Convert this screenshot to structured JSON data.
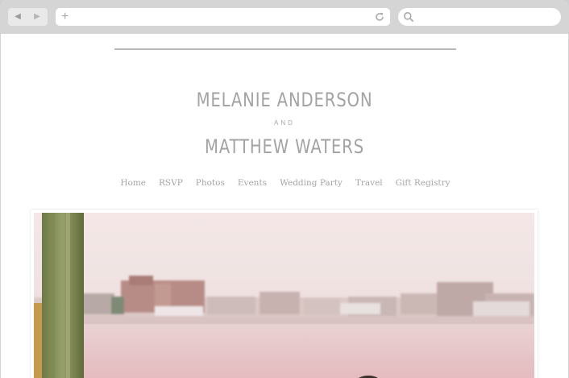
{
  "browser": {
    "back_icon": "back-arrow-icon",
    "forward_icon": "forward-arrow-icon",
    "new_tab_icon": "plus-icon",
    "reload_icon": "reload-icon",
    "search_icon": "search-icon",
    "address_value": "",
    "search_value": ""
  },
  "site": {
    "name_1": "MELANIE ANDERSON",
    "and": "AND",
    "name_2": "MATTHEW WATERS",
    "nav": [
      "Home",
      "RSVP",
      "Photos",
      "Events",
      "Wedding Party",
      "Travel",
      "Gift Registry"
    ]
  },
  "colors": {
    "browser_chrome": "#d3d3d4",
    "page_bg": "#ffffff",
    "text_gray": "#a3a3a3",
    "water_pink": "#e6c0c3"
  }
}
